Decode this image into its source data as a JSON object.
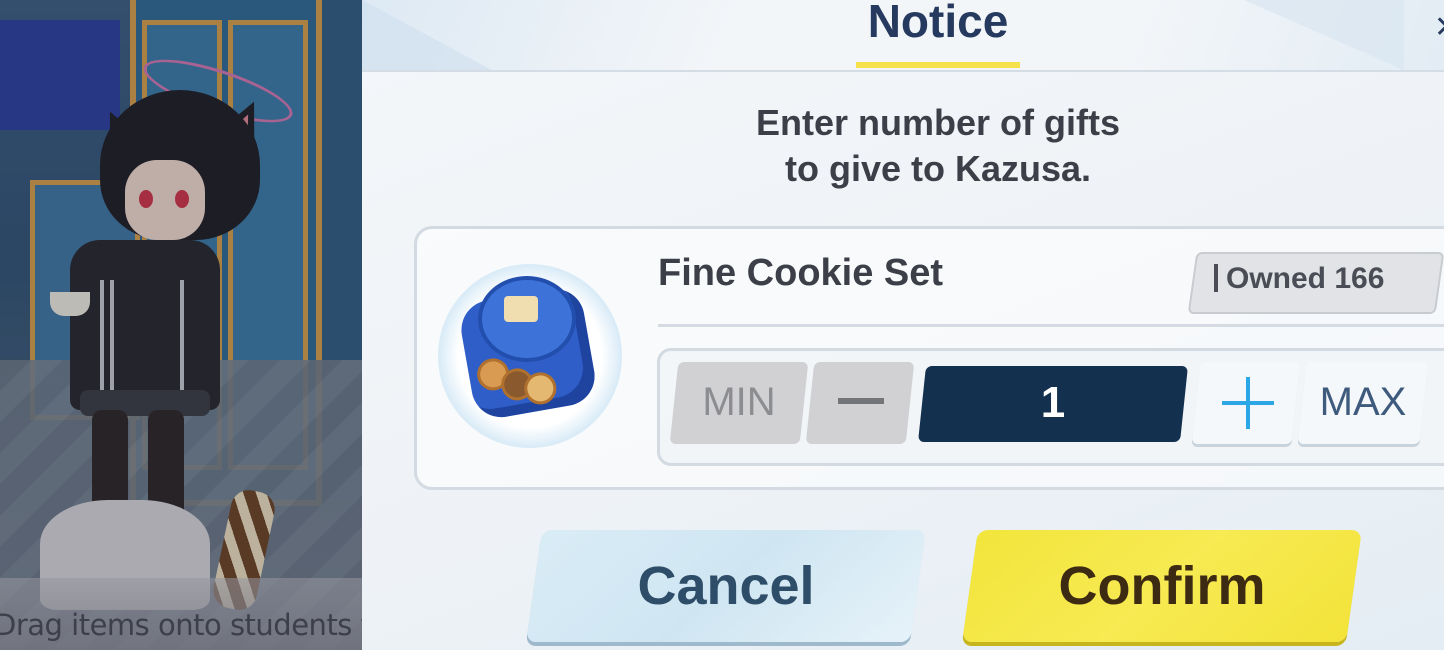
{
  "scene": {
    "hint_text": "Drag items onto students t"
  },
  "dialog": {
    "title": "Notice",
    "close_glyph": "✕",
    "message_line1": "Enter number of gifts",
    "message_line2": "to give to Kazusa.",
    "item": {
      "name": "Fine Cookie Set",
      "owned_label": "Owned",
      "owned_count": "166",
      "icon": "cookie-tin-icon"
    },
    "stepper": {
      "min_label": "MIN",
      "max_label": "MAX",
      "quantity": "1",
      "minus_icon": "minus-icon",
      "plus_icon": "plus-icon"
    },
    "buttons": {
      "cancel": "Cancel",
      "confirm": "Confirm"
    }
  },
  "colors": {
    "title": "#253a5e",
    "accent_underline": "#f5e14a",
    "quantity_field": "#14304f",
    "confirm": "#f2e53c",
    "cancel": "#d9ecf6",
    "plus": "#2ba6e6"
  }
}
